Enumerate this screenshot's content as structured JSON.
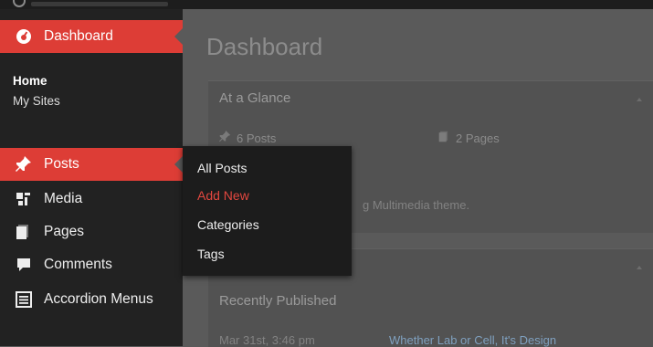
{
  "sidebar": {
    "dashboard_label": "Dashboard",
    "dashboard_sub": [
      "Home",
      "My Sites"
    ],
    "items": [
      {
        "label": "Posts",
        "icon": "pin-icon"
      },
      {
        "label": "Media",
        "icon": "media-icon"
      },
      {
        "label": "Pages",
        "icon": "pages-icon"
      },
      {
        "label": "Comments",
        "icon": "comment-icon"
      },
      {
        "label": "Accordion Menus",
        "icon": "list-icon"
      }
    ]
  },
  "flyout": {
    "items": [
      "All Posts",
      "Add New",
      "Categories",
      "Tags"
    ],
    "highlighted": "Add New"
  },
  "main": {
    "title": "Dashboard",
    "at_a_glance": {
      "heading": "At a Glance",
      "posts": "6 Posts",
      "pages": "2 Pages",
      "theme_text": "g Multimedia theme."
    },
    "activity": {
      "heading": "Recently Published",
      "date": "Mar 31st, 3:46 pm",
      "post_link": "Whether Lab or Cell, It's Design"
    }
  },
  "colors": {
    "accent": "#dd3d36",
    "sidebar_bg": "#222222",
    "content_bg": "#5a5a5a",
    "flyout_bg": "#1c1c1c",
    "highlight_text": "#e2473f"
  }
}
